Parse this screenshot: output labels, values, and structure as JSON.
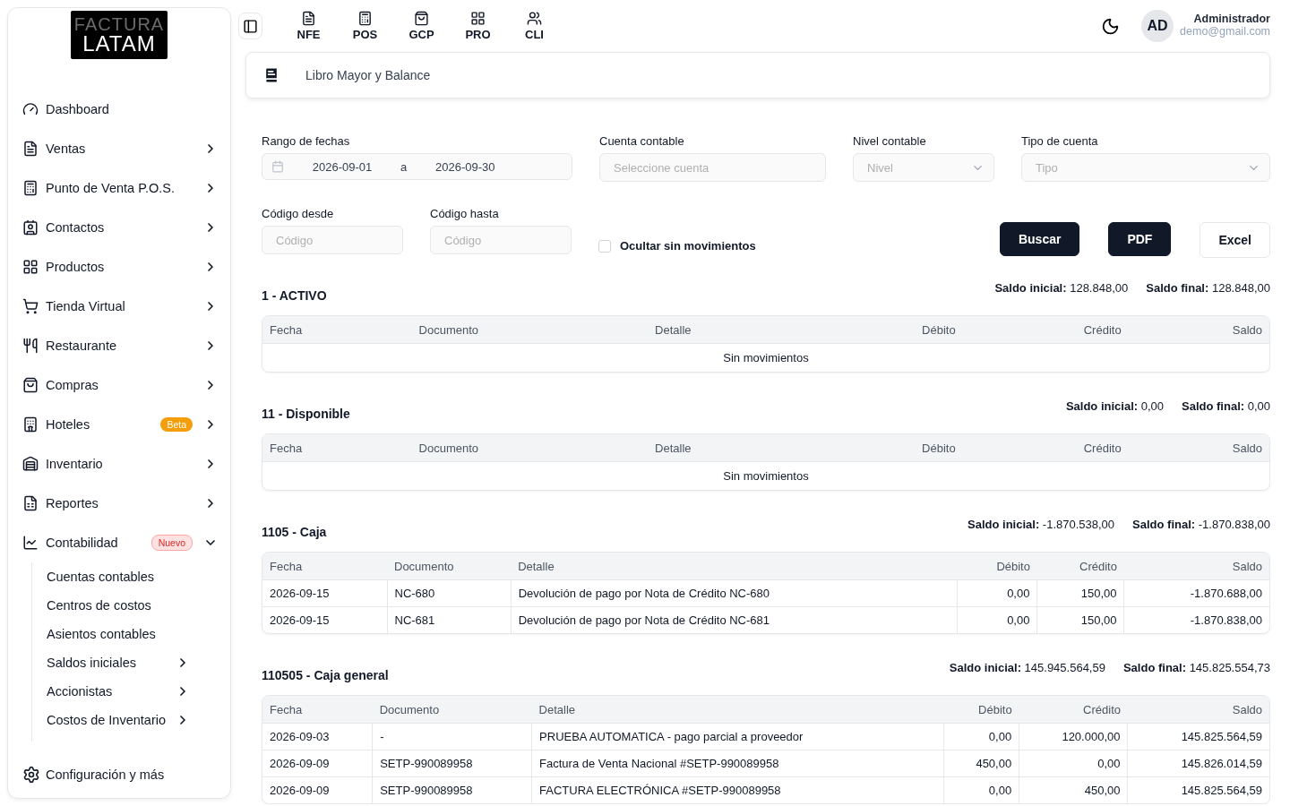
{
  "logo": {
    "line1": "FACTURA",
    "line2": "LATAM"
  },
  "topnav": [
    {
      "label": "NFE"
    },
    {
      "label": "POS"
    },
    {
      "label": "GCP"
    },
    {
      "label": "PRO"
    },
    {
      "label": "CLI"
    }
  ],
  "user": {
    "initials": "AD",
    "name": "Administrador",
    "email": "demo@gmail.com"
  },
  "sidebar": {
    "items": [
      {
        "label": "Dashboard"
      },
      {
        "label": "Ventas",
        "expanded": false
      },
      {
        "label": "Punto de Venta P.O.S.",
        "expanded": false
      },
      {
        "label": "Contactos",
        "expanded": false
      },
      {
        "label": "Productos",
        "expanded": false
      },
      {
        "label": "Tienda Virtual",
        "expanded": false
      },
      {
        "label": "Restaurante",
        "expanded": false
      },
      {
        "label": "Compras",
        "expanded": false
      },
      {
        "label": "Hoteles",
        "expanded": false,
        "badge": {
          "text": "Beta",
          "kind": "solid"
        }
      },
      {
        "label": "Inventario",
        "expanded": false
      },
      {
        "label": "Reportes",
        "expanded": false
      },
      {
        "label": "Contabilidad",
        "expanded": true,
        "badge": {
          "text": "Nuevo",
          "kind": "outline"
        },
        "children": [
          {
            "label": "Cuentas contables"
          },
          {
            "label": "Centros de costos"
          },
          {
            "label": "Asientos contables"
          },
          {
            "label": "Saldos iniciales",
            "expanded": false
          },
          {
            "label": "Accionistas",
            "expanded": false
          },
          {
            "label": "Costos de Inventario",
            "expanded": false
          }
        ]
      }
    ],
    "footer": "Configuración y más"
  },
  "page_title": "Libro Mayor y Balance",
  "filters": {
    "date_range": {
      "label": "Rango de fechas",
      "from": "2026-09-01",
      "separator": "a",
      "to": "2026-09-30"
    },
    "account": {
      "label": "Cuenta contable",
      "placeholder": "Seleccione cuenta"
    },
    "level": {
      "label": "Nivel contable",
      "placeholder": "Nivel"
    },
    "type": {
      "label": "Tipo de cuenta",
      "placeholder": "Tipo"
    },
    "code_from": {
      "label": "Código desde",
      "placeholder": "Código"
    },
    "code_to": {
      "label": "Código hasta",
      "placeholder": "Código"
    },
    "hide_empty": {
      "label": "Ocultar sin movimientos",
      "checked": false
    },
    "buttons": [
      {
        "label": "Buscar",
        "kind": "primary"
      },
      {
        "label": "PDF",
        "kind": "primary"
      },
      {
        "label": "Excel",
        "kind": "outline"
      }
    ]
  },
  "accounts": [
    {
      "title": "1 - ACTIVO",
      "saldo_inicial": "**Saldo inicial:** 128.848,00",
      "saldo_final": "**Saldo final:** 128.848,00",
      "columns": [
        "Fecha",
        "Documento",
        "Detalle",
        "Débito",
        "Crédito",
        "Saldo"
      ],
      "empty_text": "Sin movimientos"
    },
    {
      "title": "11 - Disponible",
      "saldo_inicial": "**Saldo inicial:** 0,00",
      "saldo_final": "**Saldo final:** 0,00",
      "columns": [
        "Fecha",
        "Documento",
        "Detalle",
        "Débito",
        "Crédito",
        "Saldo"
      ],
      "empty_text": "Sin movimientos"
    },
    {
      "title": "1105 - Caja",
      "saldo_inicial": "**Saldo inicial:** -1.870.538,00",
      "saldo_final": "**Saldo final:** -1.870.838,00",
      "columns": [
        "Fecha",
        "Documento",
        "Detalle",
        "Débito",
        "Crédito",
        "Saldo"
      ],
      "rows": [
        [
          "2026-09-15",
          "NC-680",
          "Devolución de pago por Nota de Crédito NC-680",
          "0,00",
          "150,00",
          "-1.870.688,00"
        ],
        [
          "2026-09-15",
          "NC-681",
          "Devolución de pago por Nota de Crédito NC-681",
          "0,00",
          "150,00",
          "-1.870.838,00"
        ]
      ]
    },
    {
      "title": "110505 - Caja general",
      "saldo_inicial": "**Saldo inicial:** 145.945.564,59",
      "saldo_final": "**Saldo final:** 145.825.554,73",
      "columns": [
        "Fecha",
        "Documento",
        "Detalle",
        "Débito",
        "Crédito",
        "Saldo"
      ],
      "rows": [
        [
          "2026-09-03",
          "-",
          "PRUEBA AUTOMATICA - pago parcial a proveedor",
          "0,00",
          "120.000,00",
          "145.825.564,59"
        ],
        [
          "2026-09-09",
          "SETP-990089958",
          "Factura de Venta Nacional #SETP-990089958",
          "450,00",
          "0,00",
          "145.826.014,59"
        ],
        [
          "2026-09-09",
          "SETP-990089958",
          "FACTURA ELECTRÓNICA #SETP-990089958",
          "0,00",
          "450,00",
          "145.825.564,59"
        ]
      ]
    }
  ]
}
